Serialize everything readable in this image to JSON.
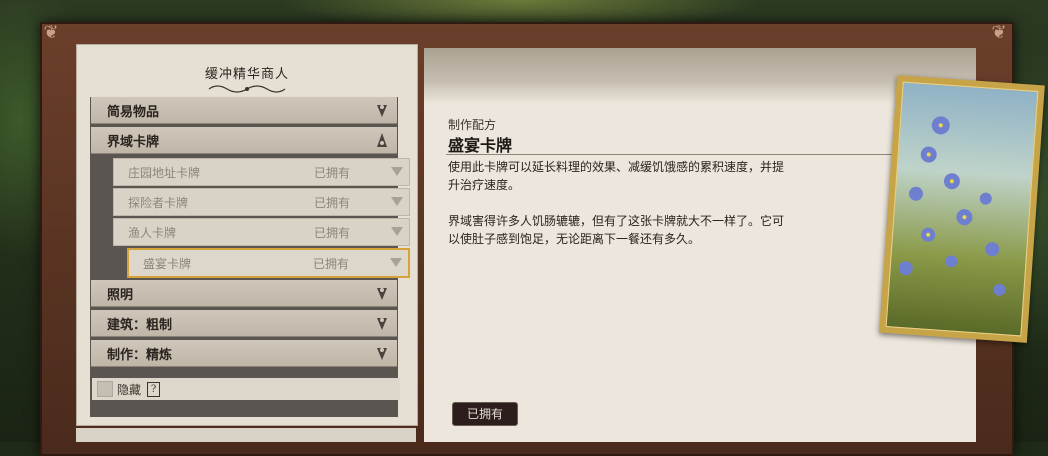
{
  "merchant_title": "缓冲精华商人",
  "menu": {
    "categories": [
      {
        "label": "简易物品",
        "expanded": false
      },
      {
        "label": "界域卡牌",
        "expanded": true
      },
      {
        "label": "照明",
        "expanded": false
      },
      {
        "label": "建筑：粗制",
        "expanded": false
      },
      {
        "label": "制作：精炼",
        "expanded": false
      }
    ],
    "realm_cards": [
      {
        "label": "庄园地址卡牌",
        "status": "已拥有"
      },
      {
        "label": "探险者卡牌",
        "status": "已拥有"
      },
      {
        "label": "渔人卡牌",
        "status": "已拥有"
      },
      {
        "label": "盛宴卡牌",
        "status": "已拥有",
        "selected": true
      }
    ]
  },
  "hide": {
    "label": "隐藏",
    "help": "?"
  },
  "recipe": {
    "kind": "制作配方",
    "name": "盛宴卡牌",
    "description": "使用此卡牌可以延长料理的效果、减缓饥饿感的累积速度，并提\n升治疗速度。\n\n界域害得许多人饥肠辘辘，但有了这张卡牌就大不一样了。它可\n以使肚子感到饱足，无论距离下一餐还有多久。",
    "owned_button": "已拥有"
  },
  "colors": {
    "panel": "#e6dfd4",
    "frame": "#5a3323",
    "selected_border": "#d6a23a",
    "button_bg": "#2b1e1c"
  }
}
